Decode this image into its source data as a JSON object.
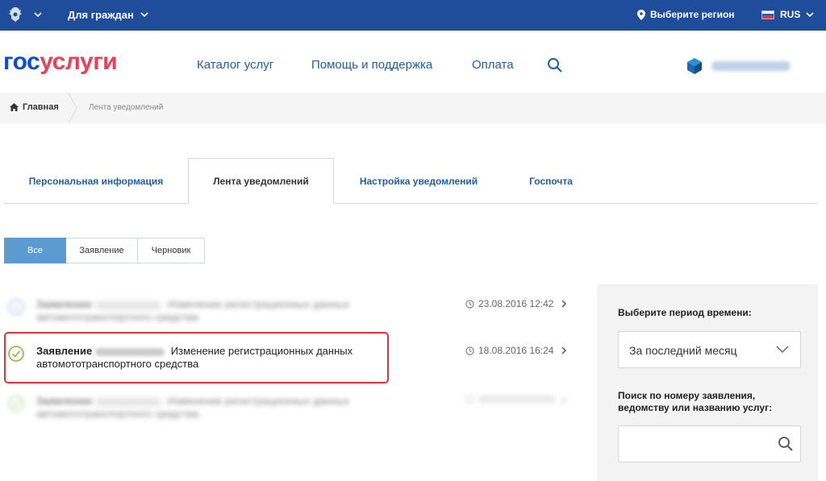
{
  "topbar": {
    "for_citizens": "Для граждан",
    "region": "Выберите регион",
    "lang": "RUS",
    "colors": {
      "bg": "#1f4d9c"
    }
  },
  "header": {
    "logo_part1": "гос",
    "logo_part2": "услуги",
    "nav": [
      "Каталог услуг",
      "Помощь и поддержка",
      "Оплата"
    ]
  },
  "breadcrumb": {
    "home": "Главная",
    "current": "Лента уведомлений"
  },
  "tabs": [
    "Персональная информация",
    "Лента уведомлений",
    "Настройка уведомлений",
    "Госпочта"
  ],
  "filters": [
    "Все",
    "Заявление",
    "Черновик"
  ],
  "notifications": [
    {
      "title": "Заявление",
      "text": "Изменение регистрационных данных автомототранспортного средства",
      "time": "23.08.2016 12:42",
      "icon": "info-icon"
    },
    {
      "title": "Заявление",
      "text": "Изменение регистрационных данных автомототранспортного средства",
      "time": "18.08.2016 16:24",
      "icon": "check-circle-icon"
    },
    {
      "title": "Заявление",
      "text": "Изменение регистрационных данных автомототранспортного средства",
      "time": "",
      "icon": "check-circle-icon"
    }
  ],
  "side": {
    "period_label": "Выберите период времени:",
    "period_value": "За последний месяц",
    "search_label": "Поиск по номеру заявления, ведомству или названию услуг:",
    "search_value": ""
  }
}
